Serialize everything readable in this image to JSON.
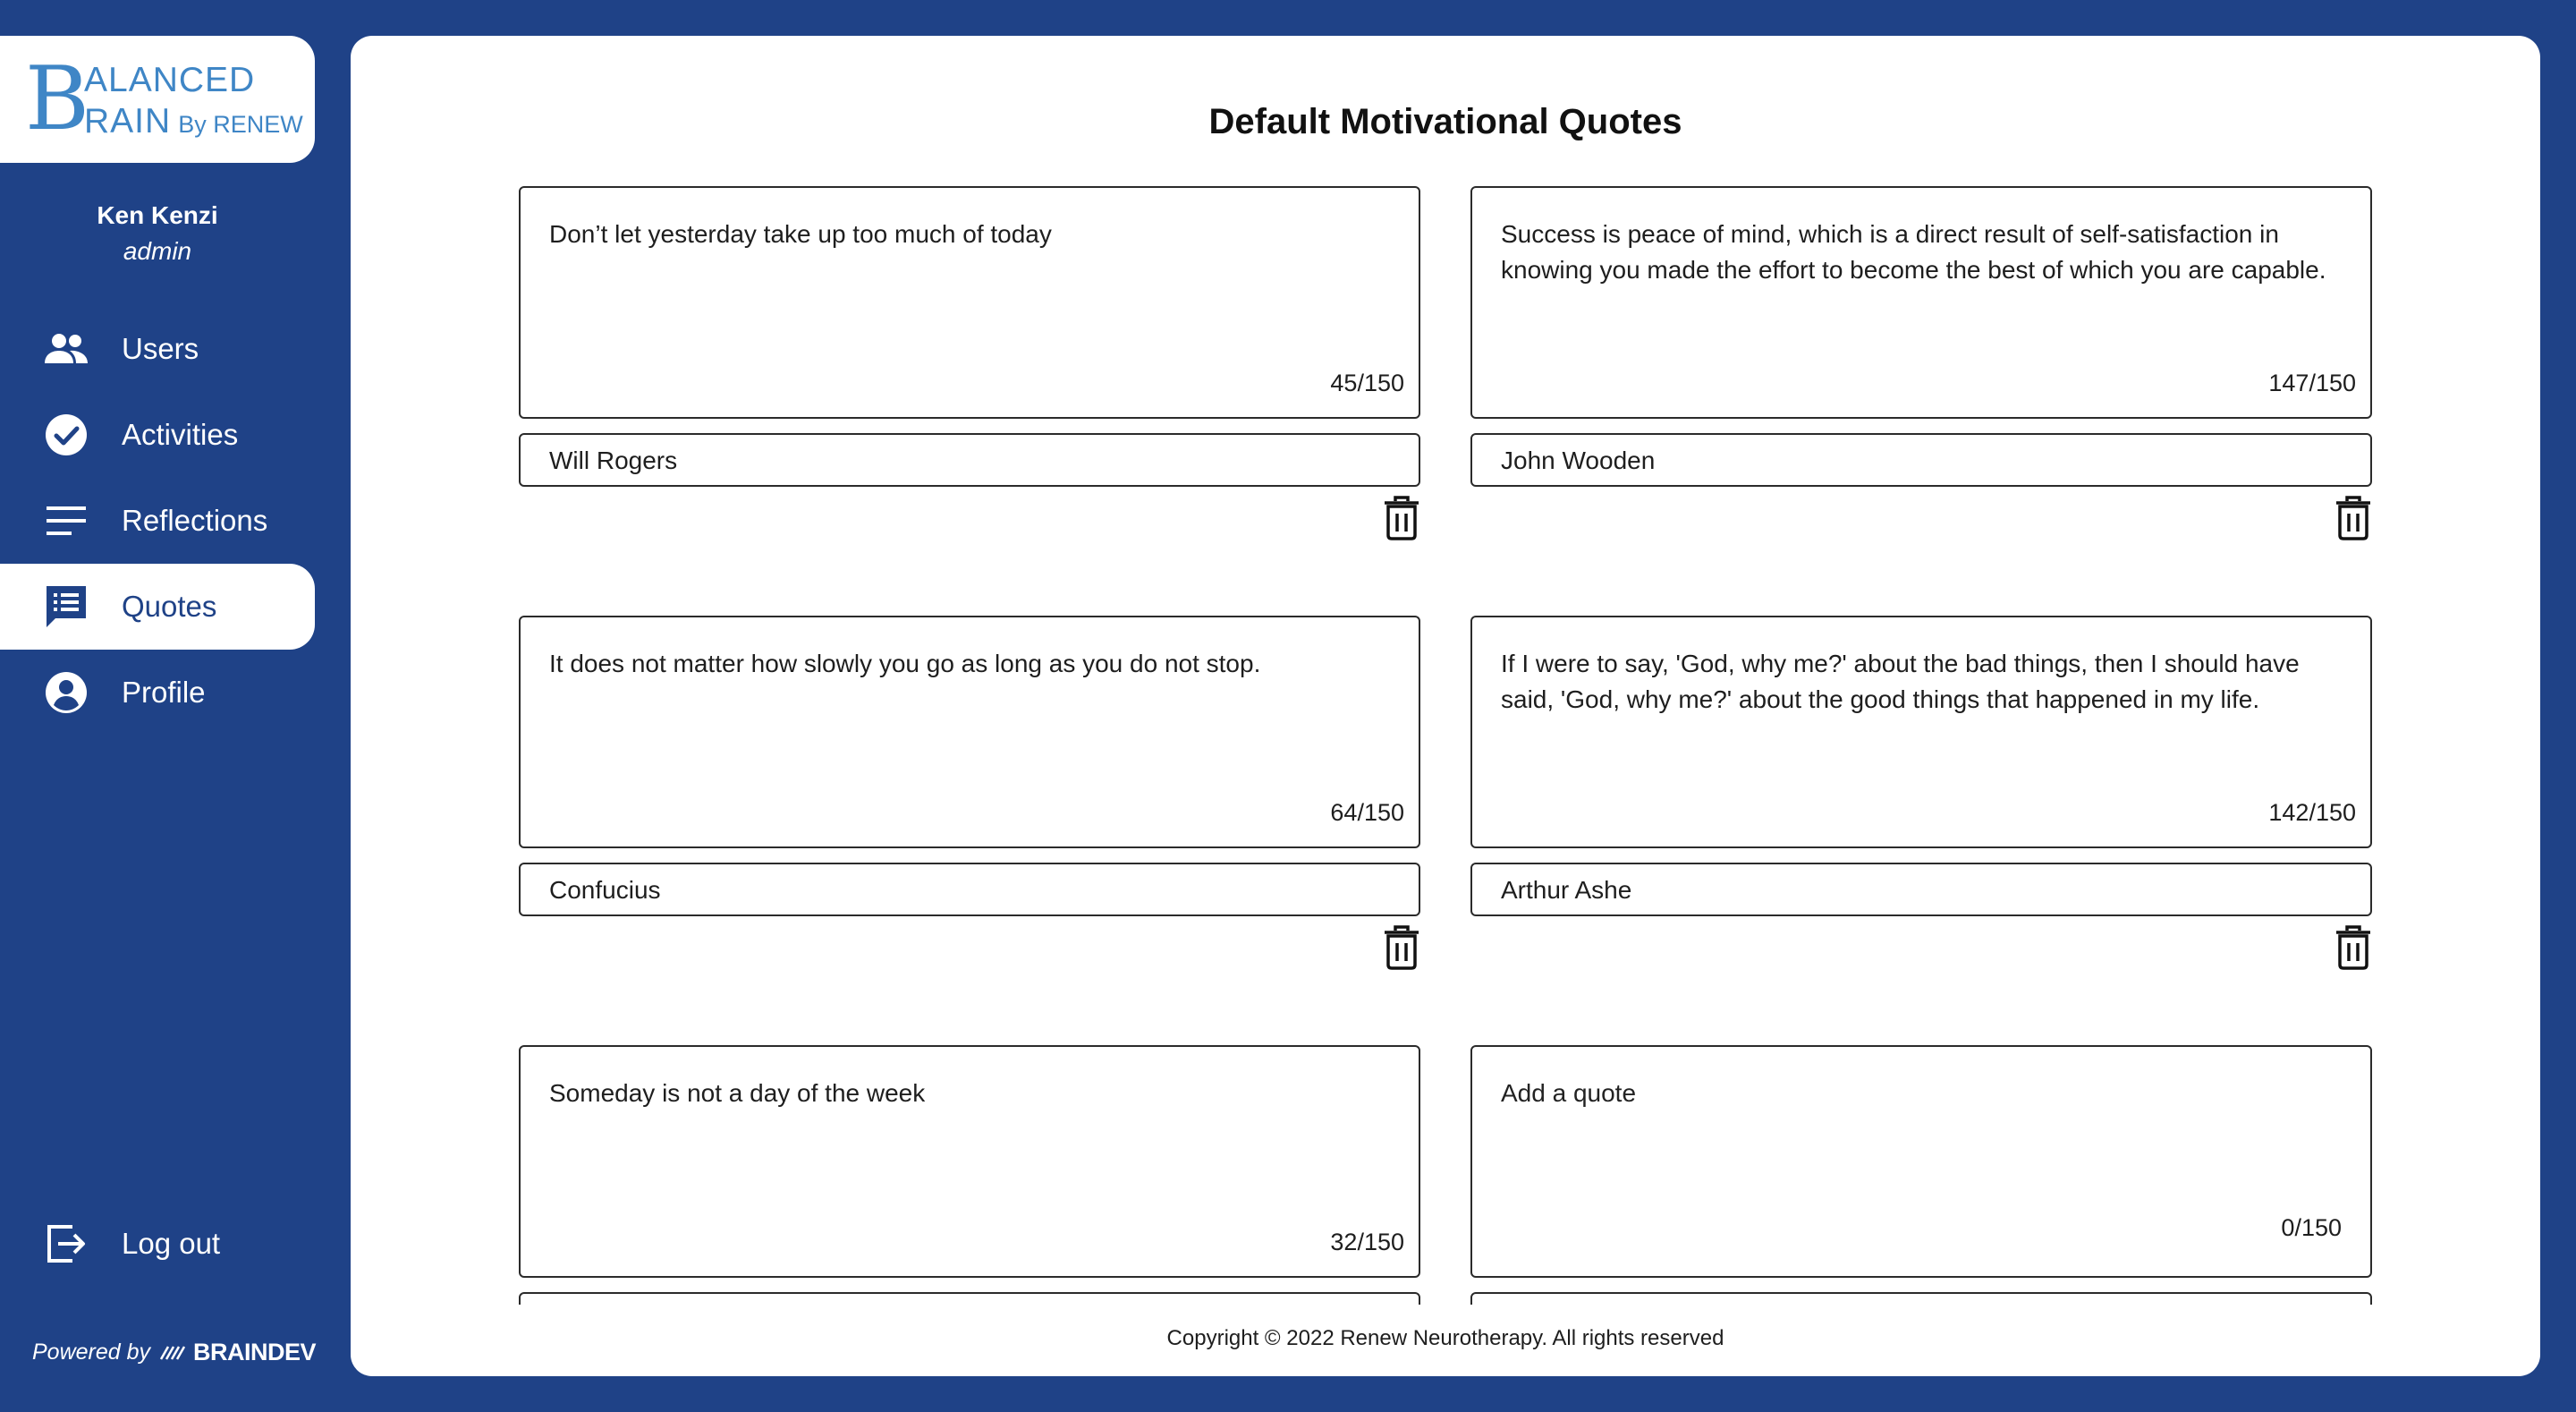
{
  "brand": {
    "logo_letter": "B",
    "logo_line1": "ALANCED",
    "logo_line2": "RAIN",
    "logo_sub": "By RENEW"
  },
  "user": {
    "name": "Ken Kenzi",
    "role": "admin"
  },
  "nav": {
    "items": [
      {
        "label": "Users",
        "icon": "users-icon",
        "active": false
      },
      {
        "label": "Activities",
        "icon": "check-circle-icon",
        "active": false
      },
      {
        "label": "Reflections",
        "icon": "lines-icon",
        "active": false
      },
      {
        "label": "Quotes",
        "icon": "quote-list-icon",
        "active": true
      },
      {
        "label": "Profile",
        "icon": "account-circle-icon",
        "active": false
      }
    ],
    "logout_label": "Log out"
  },
  "powered": {
    "prefix": "Powered by",
    "brand": "BRAINDEV"
  },
  "page": {
    "title": "Default Motivational Quotes"
  },
  "quotes": [
    {
      "text": "Don’t let yesterday take up too much of today",
      "counter": "45/150",
      "author": "Will Rogers"
    },
    {
      "text": "Success is peace of mind, which is a direct result of self-satisfaction in knowing you made the effort to become the best of which you are capable.",
      "counter": "147/150",
      "author": "John Wooden"
    },
    {
      "text": "It does not matter how slowly you go as long as you do not stop.",
      "counter": "64/150",
      "author": "Confucius"
    },
    {
      "text": "If I were to say, 'God, why me?' about the bad things, then I should have said, 'God, why me?' about the good things that happened in my life.",
      "counter": "142/150",
      "author": "Arthur Ashe"
    },
    {
      "text": "Someday is not a day of the week",
      "counter": "32/150",
      "author": ""
    }
  ],
  "new_quote": {
    "placeholder": "Add a quote",
    "counter": "0/150"
  },
  "footer": {
    "copyright": "Copyright © 2022 Renew Neurotherapy. All rights reserved"
  },
  "colors": {
    "sidebar_bg": "#1f4287",
    "logo_blue": "#3f86c6",
    "panel_bg": "#ffffff"
  }
}
